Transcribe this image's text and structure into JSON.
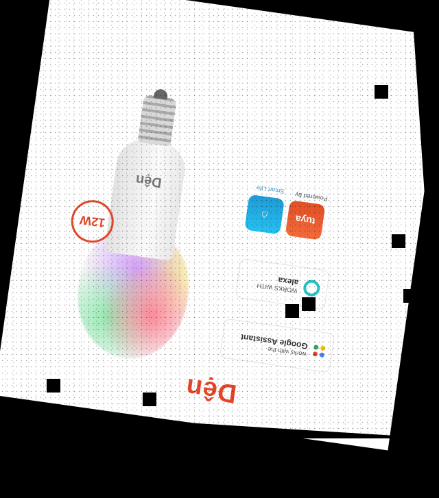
{
  "brand": {
    "name": "Dện",
    "accent": "#e2472b"
  },
  "bulb": {
    "brand_label": "Dện",
    "wattage": "12W"
  },
  "badges": {
    "google": {
      "line1": "works with the",
      "line2": "Google Assistant"
    },
    "alexa": {
      "line1": "WORKS WITH",
      "line2": "alexa"
    },
    "smartlife": {
      "caption": "Smart Life"
    },
    "tuya": {
      "label": "tuya",
      "caption": "Powered by"
    }
  },
  "icons": [
    "google-assistant-icon",
    "alexa-ring-icon",
    "smart-life-app-icon",
    "tuya-app-icon",
    "light-bulb"
  ]
}
